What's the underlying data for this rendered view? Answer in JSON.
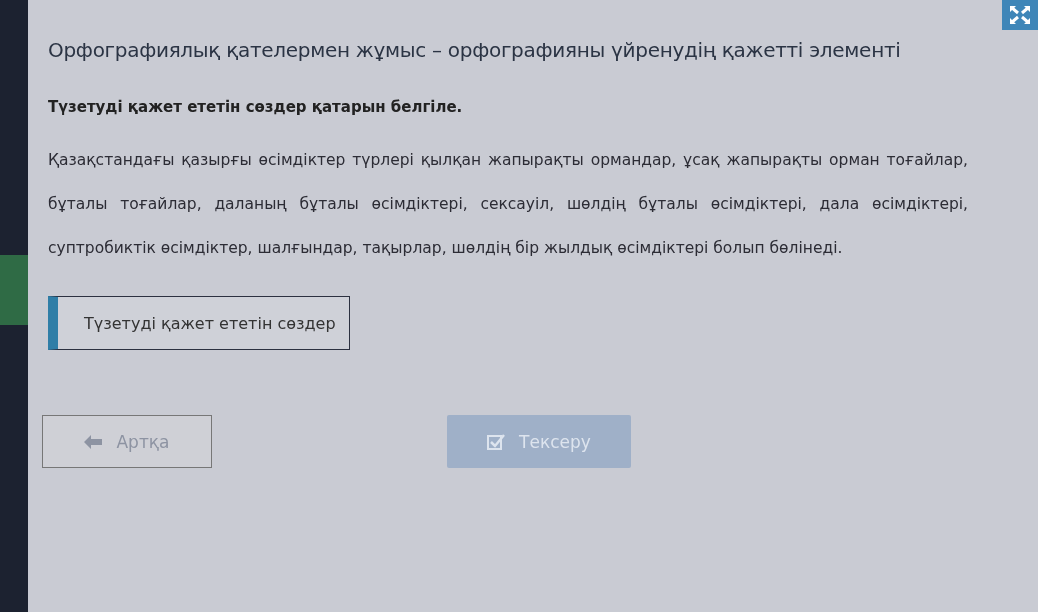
{
  "title": "Орфографиялық қателермен жұмыс – орфографияны үйренудің қажетті элементі",
  "instruction": "Түзетуді қажет ететін сөздер қатарын белгіле.",
  "paragraph": "Қазақстандағы қазырғы өсімдіктер түрлері қылқан жапырақты ормандар, ұсақ жапырақты орман тоғайлар, бұталы тоғайлар, даланың бұталы өсімдіктері, сексауіл, шөлдің бұталы өсімдіктері, дала өсімдіктері, суптробиктік өсімдіктер, шалғындар, тақырлар, шөлдің бір жылдық өсімдіктері болып бөлінеді.",
  "options": [
    {
      "label": "Түзетуді қажет ететін сөздер",
      "selected": false
    }
  ],
  "back_button": {
    "label": "Артқа"
  },
  "check_button": {
    "label": "Тексеру",
    "disabled": true
  }
}
